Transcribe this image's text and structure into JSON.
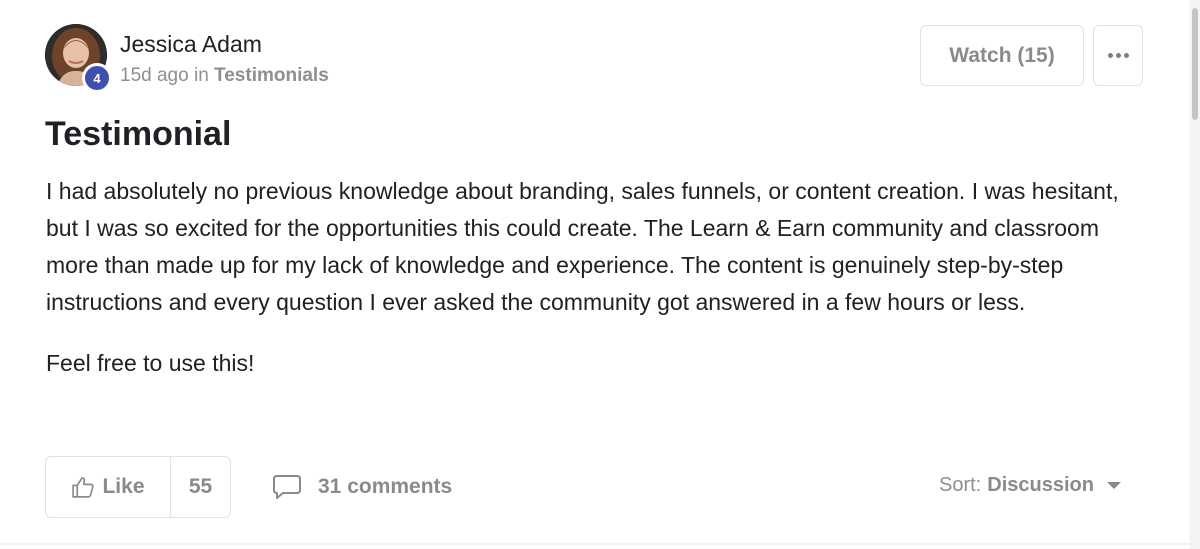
{
  "author": {
    "name": "Jessica Adam",
    "level": "4",
    "time_ago": "15d ago",
    "in_label": "in",
    "group": "Testimonials"
  },
  "actions": {
    "watch_label": "Watch (15)",
    "more_icon": "more-horizontal-icon"
  },
  "post": {
    "title": "Testimonial",
    "paragraphs": [
      "I had absolutely no previous knowledge about branding, sales funnels, or content creation. I was hesitant, but I was so excited for the opportunities this could create. The Learn & Earn community and classroom more than made up for my lack of knowledge and experience. The content is genuinely step-by-step instructions and every question I ever asked the community got answered in a few hours or less.",
      "Feel free to use this!"
    ]
  },
  "engagement": {
    "like_label": "Like",
    "like_icon": "thumbs-up-icon",
    "like_count": "55",
    "comments_label": "31 comments",
    "comments_icon": "comment-bubble-icon"
  },
  "sort": {
    "label": "Sort:",
    "value": "Discussion",
    "icon": "caret-down-icon"
  },
  "colors": {
    "badge": "#3f4fb1",
    "muted_text": "#8a8a8a",
    "border": "#e1e1e1"
  }
}
